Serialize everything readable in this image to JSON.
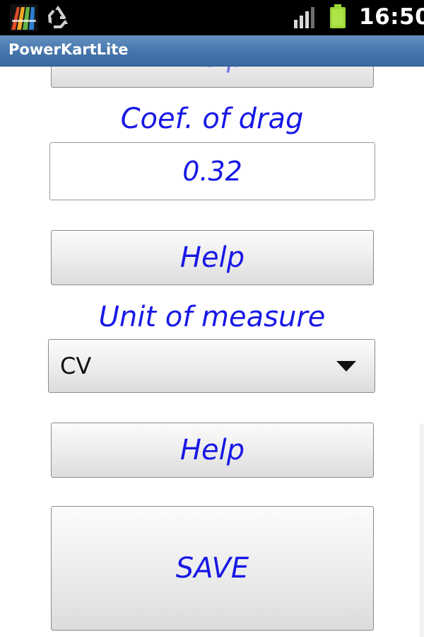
{
  "status_bar": {
    "clock": "16:50",
    "icons": [
      "app-logo-icon",
      "recycle-icon",
      "signal-icon",
      "battery-icon"
    ],
    "battery_color": "#9cd636"
  },
  "app": {
    "title": "PowerKartLite",
    "title_bar_color": "#4474ab"
  },
  "form": {
    "help_label": "Help",
    "drag": {
      "label": "Coef. of drag",
      "value": "0.32"
    },
    "unit": {
      "label": "Unit of measure",
      "selected": "CV"
    },
    "save_label": "SAVE",
    "accent_color": "#1818e6"
  }
}
